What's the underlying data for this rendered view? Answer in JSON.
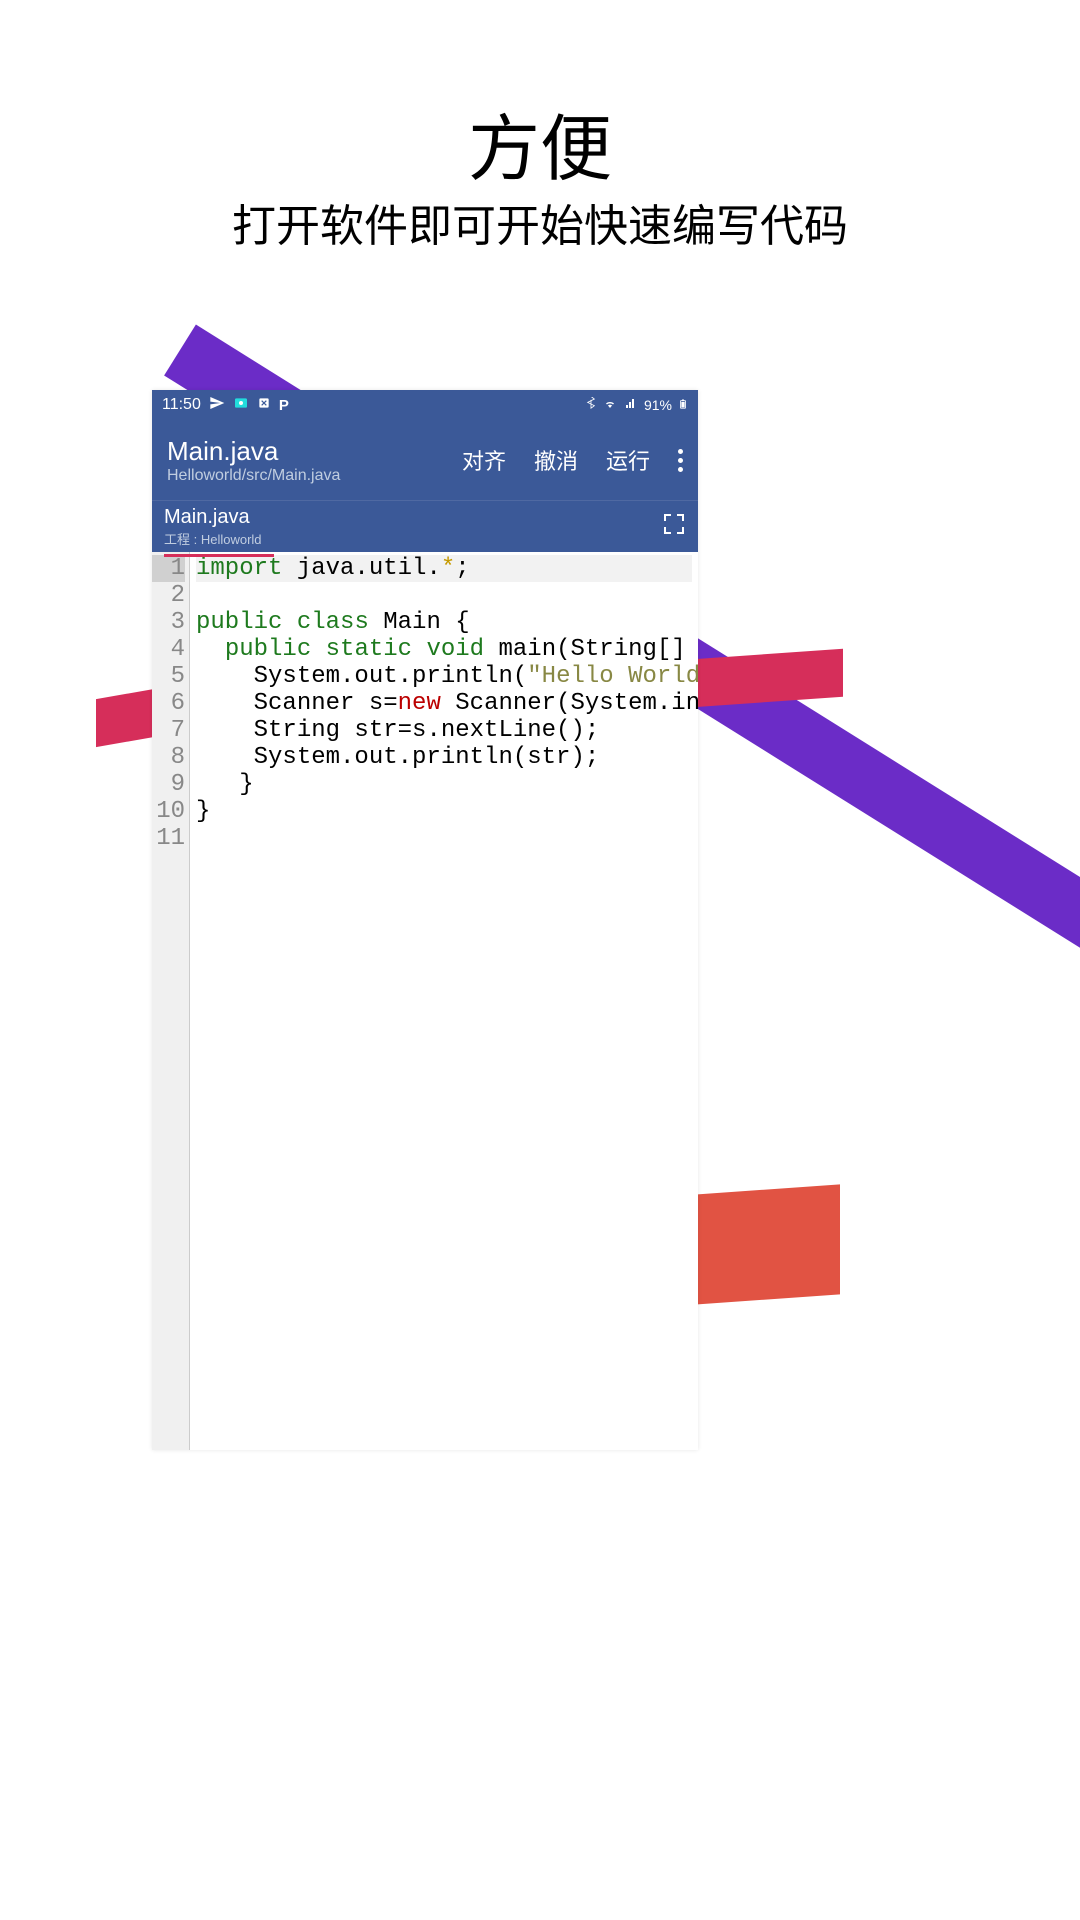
{
  "promo": {
    "title": "方便",
    "subtitle": "打开软件即可开始快速编写代码"
  },
  "statusBar": {
    "time": "11:50",
    "battery": "91%"
  },
  "appBar": {
    "title": "Main.java",
    "path": "Helloworld/src/Main.java",
    "actions": {
      "align": "对齐",
      "undo": "撤消",
      "run": "运行"
    }
  },
  "tab": {
    "name": "Main.java",
    "project": "工程 : Helloworld"
  },
  "code": {
    "lineCount": 11,
    "currentLine": 1,
    "lines": [
      {
        "n": 1,
        "tokens": [
          [
            "kw",
            "import"
          ],
          [
            "",
            ""
          ],
          [
            "",
            " java.util."
          ],
          [
            "star",
            "*"
          ],
          [
            "",
            ";"
          ]
        ]
      },
      {
        "n": 2,
        "tokens": []
      },
      {
        "n": 3,
        "tokens": [
          [
            "kw",
            "public"
          ],
          [
            "",
            " "
          ],
          [
            "kw",
            "class"
          ],
          [
            "",
            " Main {"
          ]
        ]
      },
      {
        "n": 4,
        "tokens": [
          [
            "",
            "  "
          ],
          [
            "kw",
            "public"
          ],
          [
            "",
            " "
          ],
          [
            "kw",
            "static"
          ],
          [
            "",
            " "
          ],
          [
            "kw",
            "void"
          ],
          [
            "",
            " main(String[]"
          ]
        ]
      },
      {
        "n": 5,
        "tokens": [
          [
            "",
            "    System.out.println("
          ],
          [
            "str",
            "\"Hello World"
          ]
        ]
      },
      {
        "n": 6,
        "tokens": [
          [
            "",
            "    Scanner s="
          ],
          [
            "neww",
            "new"
          ],
          [
            "",
            " Scanner(System.in"
          ]
        ]
      },
      {
        "n": 7,
        "tokens": [
          [
            "",
            "    String str=s.nextLine();"
          ]
        ]
      },
      {
        "n": 8,
        "tokens": [
          [
            "",
            "    System.out.println(str);"
          ]
        ]
      },
      {
        "n": 9,
        "tokens": [
          [
            "",
            "   }"
          ]
        ]
      },
      {
        "n": 10,
        "tokens": [
          [
            "",
            "}"
          ]
        ]
      },
      {
        "n": 11,
        "tokens": []
      }
    ]
  }
}
